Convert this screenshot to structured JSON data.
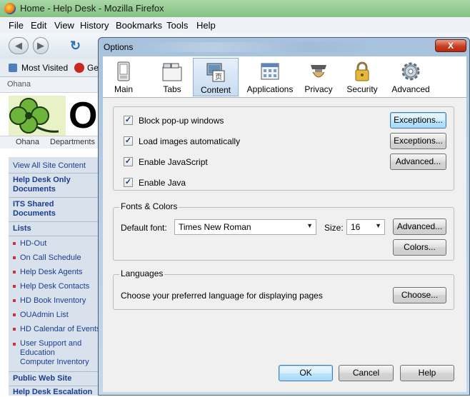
{
  "window": {
    "title": "Home - Help Desk - Mozilla Firefox"
  },
  "menubar": [
    "File",
    "Edit",
    "View",
    "History",
    "Bookmarks",
    "Tools",
    "Help"
  ],
  "bookmarks": {
    "most_visited": "Most Visited",
    "ge": "Ge"
  },
  "page": {
    "site_name": "Ohana",
    "logo_text": "O",
    "tabs": [
      "Ohana",
      "Departments"
    ],
    "view_all": "View All Site Content",
    "sections": [
      "Help Desk Only Documents",
      "ITS Shared Documents",
      "Lists"
    ],
    "lists": [
      "HD-Out",
      "On Call Schedule",
      "Help Desk Agents",
      "Help Desk Contacts",
      "HD Book Inventory",
      "OUAdmin List",
      "HD Calendar of Events",
      "User Support and Education Computer Inventory"
    ],
    "bottom_links": [
      "Public Web Site",
      "Help Desk Escalation"
    ]
  },
  "dialog": {
    "title": "Options",
    "close_glyph": "X",
    "panes": [
      {
        "label": "Main",
        "icon": "main-icon"
      },
      {
        "label": "Tabs",
        "icon": "tabs-icon"
      },
      {
        "label": "Content",
        "icon": "content-icon"
      },
      {
        "label": "Applications",
        "icon": "applications-icon"
      },
      {
        "label": "Privacy",
        "icon": "privacy-icon"
      },
      {
        "label": "Security",
        "icon": "security-icon"
      },
      {
        "label": "Advanced",
        "icon": "advanced-icon"
      }
    ],
    "selected_pane": "Content",
    "content_icon_glyph": "页",
    "checkboxes": [
      {
        "label": "Block pop-up windows",
        "checked": true
      },
      {
        "label": "Load images automatically",
        "checked": true
      },
      {
        "label": "Enable JavaScript",
        "checked": true
      },
      {
        "label": "Enable Java",
        "checked": true
      }
    ],
    "check_glyph": "✓",
    "exceptions_label": "Exceptions...",
    "advanced_label": "Advanced...",
    "fonts": {
      "caption": "Fonts & Colors",
      "default_font_label": "Default font:",
      "default_font_value": "Times New Roman",
      "size_label": "Size:",
      "size_value": "16",
      "advanced_label": "Advanced...",
      "colors_label": "Colors..."
    },
    "languages": {
      "caption": "Languages",
      "description": "Choose your preferred language for displaying pages",
      "choose_label": "Choose..."
    },
    "footer": {
      "ok": "OK",
      "cancel": "Cancel",
      "help": "Help"
    },
    "accent_color": "#3c7fb1"
  }
}
